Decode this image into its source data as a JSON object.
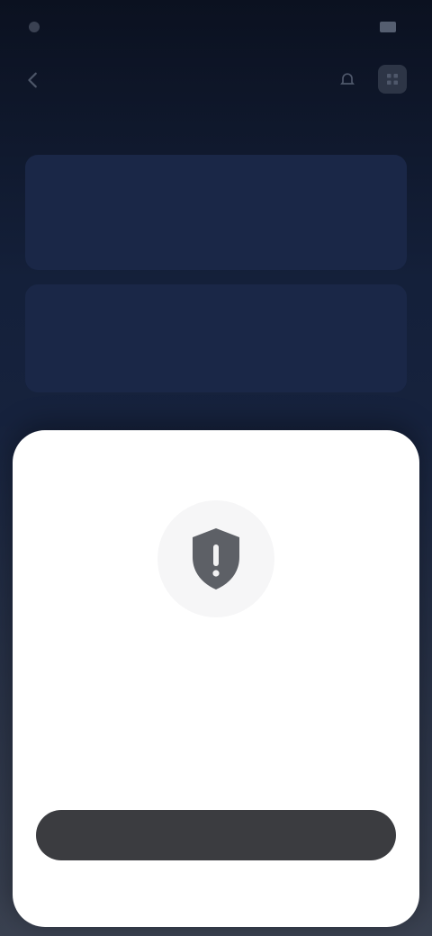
{
  "status_bar": {
    "time": "",
    "battery": ""
  },
  "nav": {
    "title": "",
    "back_icon": "chevron-left-icon",
    "action_icons": [
      "bell-icon",
      "grid-icon"
    ]
  },
  "section": {
    "label": ""
  },
  "cards": [
    {
      "line_a": "",
      "line_b": "",
      "line_c": ""
    },
    {
      "line_a": "",
      "line_b": "",
      "line_c": ""
    }
  ],
  "modal": {
    "icon": "shield-alert-icon",
    "title": "",
    "body": "",
    "button_label": ""
  }
}
